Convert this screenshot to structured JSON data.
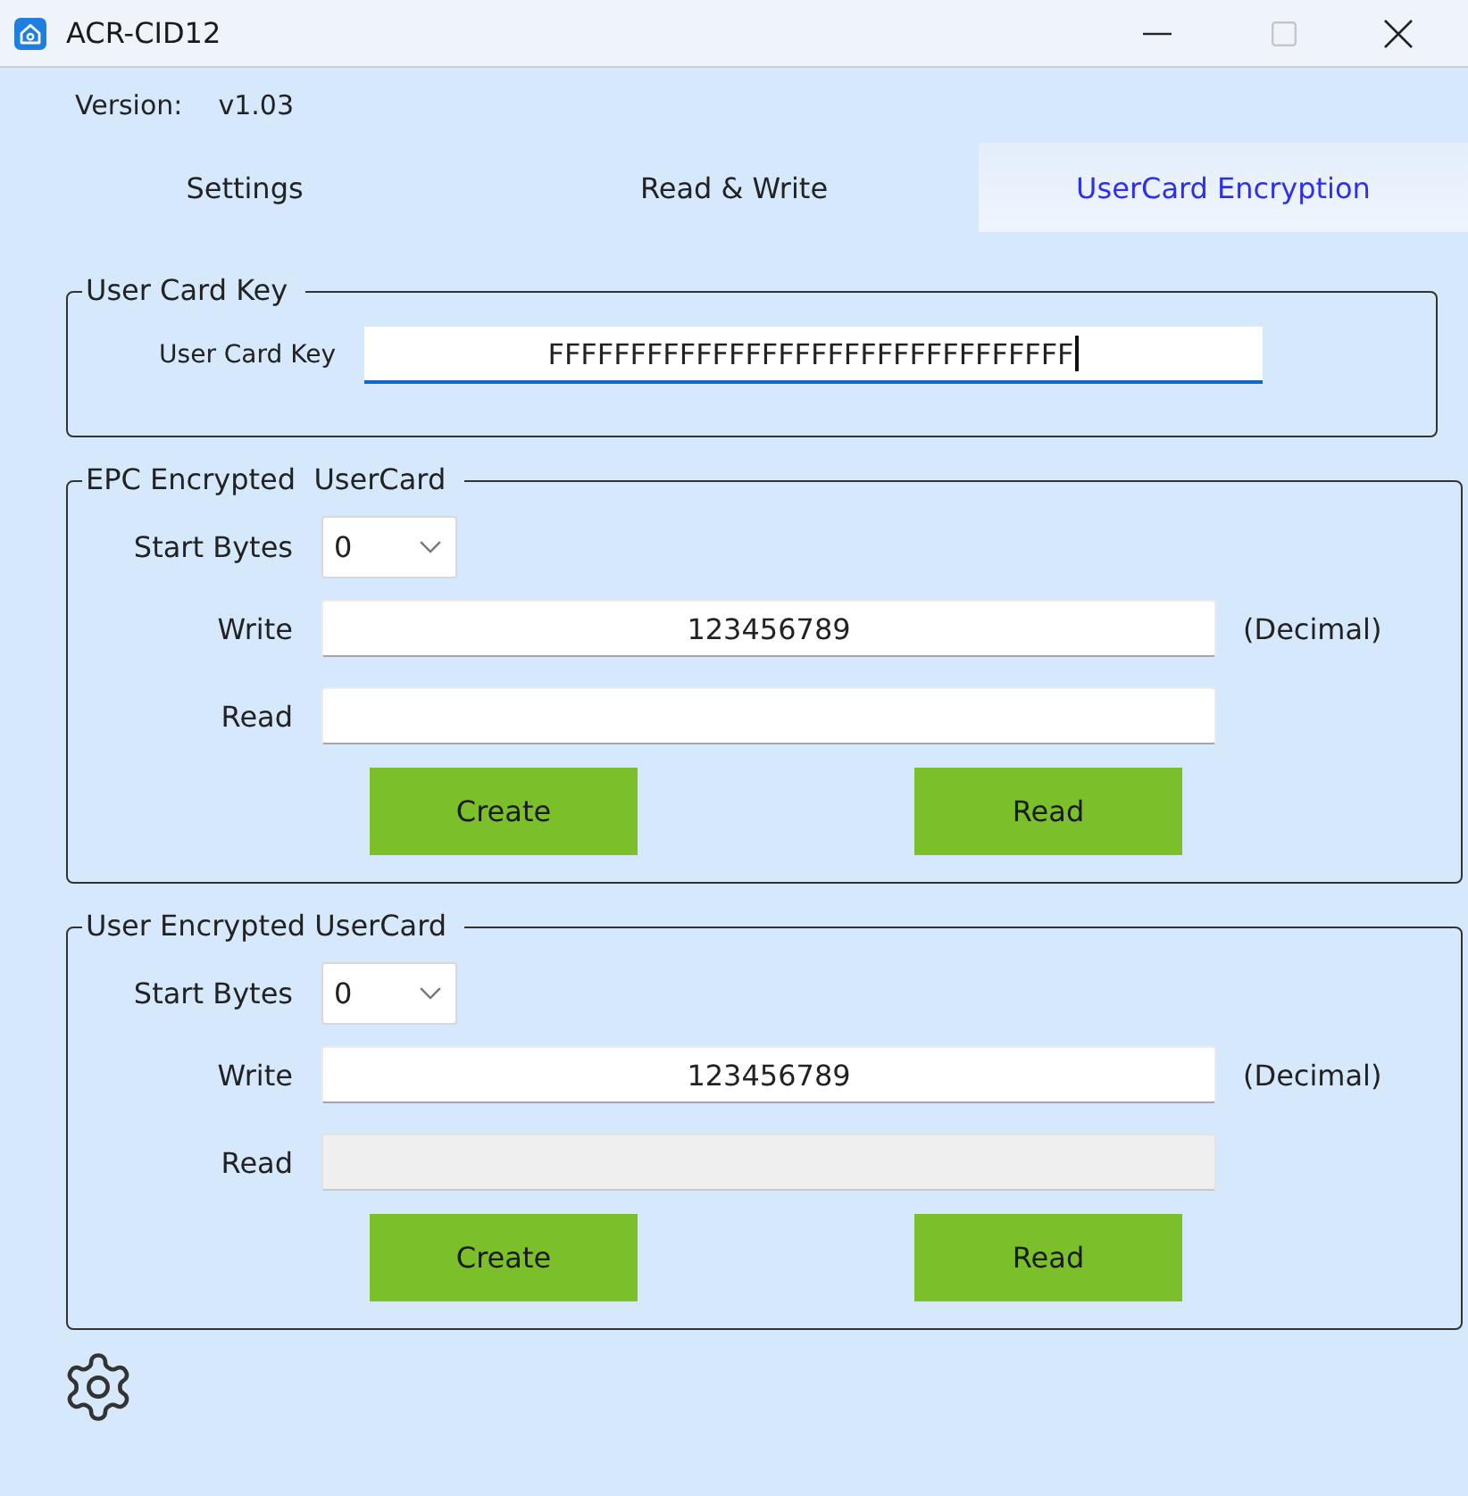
{
  "window": {
    "title": "ACR-CID12",
    "maximize_disabled": true
  },
  "version": {
    "label": "Version:",
    "value": "v1.03"
  },
  "tabs": [
    {
      "label": "Settings",
      "selected": false
    },
    {
      "label": "Read & Write",
      "selected": false
    },
    {
      "label": "UserCard Encryption",
      "selected": true
    }
  ],
  "user_card_key": {
    "title": "User Card Key",
    "label": "User Card Key",
    "value": "FFFFFFFFFFFFFFFFFFFFFFFFFFFFFFFF",
    "focused": true
  },
  "card_groups": [
    {
      "title": "EPC Encrypted  UserCard",
      "rows": [
        {
          "kind": "select",
          "label": "Start Bytes",
          "value": "0",
          "disabled": false
        },
        {
          "kind": "text",
          "label": "Write",
          "value": "123456789",
          "note": "(Decimal)",
          "disabled": false
        },
        {
          "kind": "text",
          "label": "Read",
          "disabled": false
        }
      ],
      "buttons": [
        {
          "label": "Create"
        },
        {
          "label": "Read"
        }
      ]
    },
    {
      "title": "User Encrypted UserCard",
      "rows": [
        {
          "kind": "select",
          "label": "Start Bytes",
          "value": "0",
          "disabled": false
        },
        {
          "kind": "text",
          "label": "Write",
          "value": "123456789",
          "note": "(Decimal)",
          "disabled": false
        },
        {
          "kind": "text",
          "label": "Read",
          "disabled": true
        }
      ],
      "buttons": [
        {
          "label": "Create"
        },
        {
          "label": "Read"
        }
      ]
    }
  ]
}
